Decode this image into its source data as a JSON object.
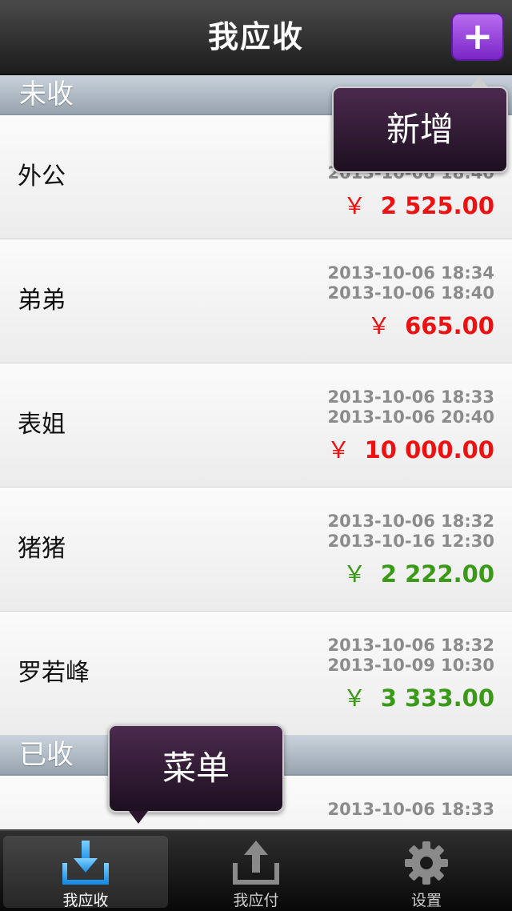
{
  "header": {
    "title": "我应收",
    "add_symbol": "+"
  },
  "sections": [
    {
      "title": "未收",
      "rows": [
        {
          "name": "外公",
          "date1": "2013-10-06 18:40",
          "date2": "",
          "currency": "￥",
          "amount": "2 525.00",
          "status_color": "red"
        },
        {
          "name": "弟弟",
          "date1": "2013-10-06 18:34",
          "date2": "2013-10-06 18:40",
          "currency": "￥",
          "amount": "665.00",
          "status_color": "red"
        },
        {
          "name": "表姐",
          "date1": "2013-10-06 18:33",
          "date2": "2013-10-06 20:40",
          "currency": "￥",
          "amount": "10 000.00",
          "status_color": "red"
        },
        {
          "name": "猪猪",
          "date1": "2013-10-06 18:32",
          "date2": "2013-10-16 12:30",
          "currency": "￥",
          "amount": "2 222.00",
          "status_color": "green"
        },
        {
          "name": "罗若峰",
          "date1": "2013-10-06 18:32",
          "date2": "2013-10-09 10:30",
          "currency": "￥",
          "amount": "3 333.00",
          "status_color": "green"
        }
      ]
    },
    {
      "title": "已收",
      "rows": [
        {
          "date1": "2013-10-06 18:33"
        }
      ]
    }
  ],
  "tooltips": {
    "new": "新增",
    "menu": "菜单"
  },
  "tabbar": {
    "tabs": [
      {
        "label": "我应收",
        "icon": "download-tray-icon",
        "active": true
      },
      {
        "label": "我应付",
        "icon": "upload-tray-icon",
        "active": false
      },
      {
        "label": "设置",
        "icon": "gear-icon",
        "active": false
      }
    ]
  },
  "colors": {
    "red": "#ee1111",
    "green": "#3a9a18",
    "accent_purple": "#8e3ad8"
  }
}
